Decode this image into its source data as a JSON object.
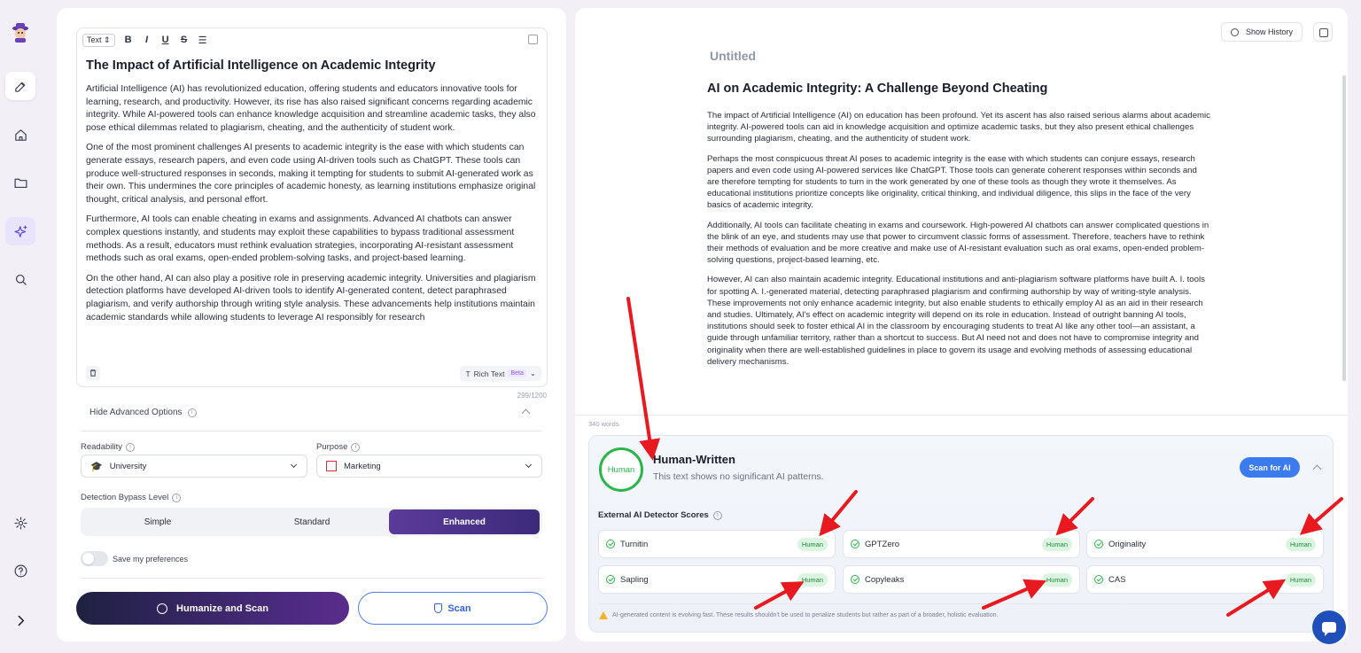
{
  "sidebar": {
    "items": [
      {
        "icon": "logo-icon"
      },
      {
        "icon": "edit-icon"
      },
      {
        "icon": "home-icon"
      },
      {
        "icon": "folder-icon"
      },
      {
        "icon": "sparkle-icon"
      },
      {
        "icon": "search-icon"
      },
      {
        "icon": "gear-icon"
      },
      {
        "icon": "help-icon"
      },
      {
        "icon": "chevron-right-icon"
      }
    ]
  },
  "editor": {
    "toolbar": {
      "format": "Text ⇕",
      "bold": "B",
      "italic": "I",
      "underline": "U",
      "strike": "S",
      "list": "☰"
    },
    "title": "The Impact of Artificial Intelligence on Academic Integrity",
    "paragraphs": [
      "Artificial Intelligence (AI) has revolutionized education, offering students and educators innovative tools for learning, research, and productivity. However, its rise has also raised significant concerns regarding academic integrity. While AI-powered tools can enhance knowledge acquisition and streamline academic tasks, they also pose ethical dilemmas related to plagiarism, cheating, and the authenticity of student work.",
      "One of the most prominent challenges AI presents to academic integrity is the ease with which students can generate essays, research papers, and even code using AI-driven tools such as ChatGPT. These tools can produce well-structured responses in seconds, making it tempting for students to submit AI-generated work as their own. This undermines the core principles of academic honesty, as learning institutions emphasize original thought, critical analysis, and personal effort.",
      "Furthermore, AI tools can enable cheating in exams and assignments. Advanced AI chatbots can answer complex questions instantly, and students may exploit these capabilities to bypass traditional assessment methods. As a result, educators must rethink evaluation strategies, incorporating AI-resistant assessment methods such as oral exams, open-ended problem-solving tasks, and project-based learning.",
      "On the other hand, AI can also play a positive role in preserving academic integrity. Universities and plagiarism detection platforms have developed AI-driven tools to identify AI-generated content, detect paraphrased plagiarism, and verify authorship through writing style analysis. These advancements help institutions maintain academic standards while allowing students to leverage AI responsibly for research"
    ],
    "rich_text_label": "Rich Text",
    "beta_label": "Beta",
    "char_count": "299/1200"
  },
  "options": {
    "toggle_label": "Hide Advanced Options",
    "readability_label": "Readability",
    "readability_value": "University",
    "purpose_label": "Purpose",
    "purpose_value": "Marketing",
    "bypass_label": "Detection Bypass Level",
    "levels": [
      "Simple",
      "Standard",
      "Enhanced"
    ],
    "selected_level": "Enhanced",
    "save_prefs_label": "Save my preferences",
    "save_prefs_on": false
  },
  "actions": {
    "humanize_label": "Humanize and Scan",
    "scan_label": "Scan"
  },
  "output": {
    "show_history_label": "Show History",
    "doc_name": "Untitled",
    "title": "AI  on Academic Integrity: A Challenge Beyond Cheating",
    "paragraphs": [
      "The impact of Artificial Intelligence (AI) on education has been profound. Yet its  ascent has also raised serious alarms about academic integrity. AI-powered tools can aid in knowledge acquisition and optimize academic tasks, but they also present ethical challenges surrounding plagiarism,  cheating, and the authenticity of student work.",
      "Perhaps the most conspicuous threat AI poses to academic integrity is the ease with which students can conjure essays, research  papers and even code using AI-powered services like ChatGPT. Those tools can  generate coherent responses within seconds and are therefore tempting for students to turn in the work generated by one of these tools as though they wrote it themselves. As  educational institutions prioritize concepts like originality, critical thinking, and individual diligence, this slips in the face of the very basics of academic integrity.",
      "Additionally,  AI tools can facilitate cheating in exams and coursework. High-powered  AI chatbots can answer complicated questions in the blink of an eye, and students may use that power to circumvent classic forms of assessment. Therefore, teachers have to rethink their methods of evaluation and be  more creative and make use of AI-resistant evaluation such as oral exams, open-ended problem-solving questions, project-based learning, etc.",
      "However,  AI can also maintain academic integrity. Educational institutions and anti-plagiarism software platforms have built A. I. tools for spotting A. I.-generated material, detecting  paraphrased plagiarism and confirming authorship by way of writing-style analysis. These  improvements not only enhance academic integrity, but also enable students to ethically employ AI as an aid in their research and studies. Ultimately, AI's  effect on academic integrity will depend on its role in education. Instead of outright banning AI tools, institutions should seek to foster ethical AI in the classroom by encouraging students to treat  AI like any other tool—an assistant, a guide through unfamiliar territory, rather than a shortcut to success. But AI need not and does not have to compromise integrity and originality when there are well-established guidelines in  place to govern its usage and evolving methods of assessing educational delivery mechanisms."
    ],
    "word_count": "340 words"
  },
  "result": {
    "ring_label": "Human",
    "verdict": "Human-Written",
    "subtext": "This text shows no significant AI patterns.",
    "scan_ai_label": "Scan for AI",
    "detectors_label": "External AI Detector Scores",
    "detectors": [
      {
        "name": "Turnitin",
        "score": "Human"
      },
      {
        "name": "GPTZero",
        "score": "Human"
      },
      {
        "name": "Originality",
        "score": "Human"
      },
      {
        "name": "Sapling",
        "score": "Human"
      },
      {
        "name": "Copyleaks",
        "score": "Human"
      },
      {
        "name": "CAS",
        "score": "Human"
      }
    ],
    "disclaimer": "AI-generated content is evolving fast. These results shouldn't be used to penalize students but rather as part of a broader, holistic evaluation."
  },
  "colors": {
    "accent": "#3a7cf0",
    "human_green": "#2bb54a",
    "annotation_red": "#e8191f",
    "brand_purple": "#4a2a7e"
  }
}
